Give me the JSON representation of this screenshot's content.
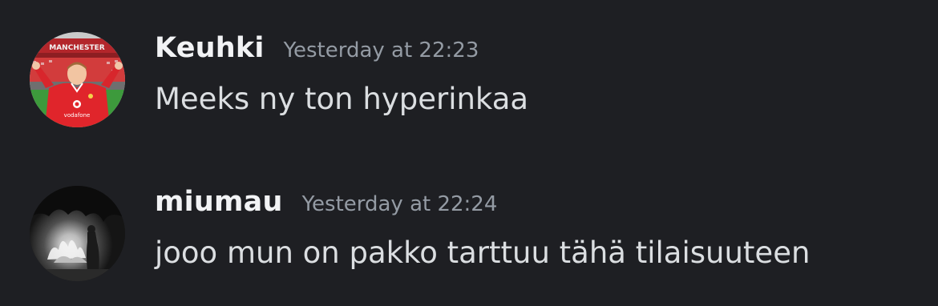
{
  "colors": {
    "background": "#1e1f23",
    "username": "#f2f3f5",
    "timestamp": "#949ba4",
    "message_text": "#dbdee1"
  },
  "messages": [
    {
      "username": "Keuhki",
      "timestamp": "Yesterday at 22:23",
      "content": "Meeks ny ton hyperinkaa",
      "avatar": {
        "icon": "avatar-football-player-red-shirt",
        "shirt_lettering": "vodafone",
        "banner_lettering": "MANCHESTER"
      }
    },
    {
      "username": "miumau",
      "timestamp": "Yesterday at 22:24",
      "content": "jooo mun on pakko tarttuu tähä tilaisuuteen",
      "avatar": {
        "icon": "avatar-bonfire-night-photo"
      }
    }
  ]
}
